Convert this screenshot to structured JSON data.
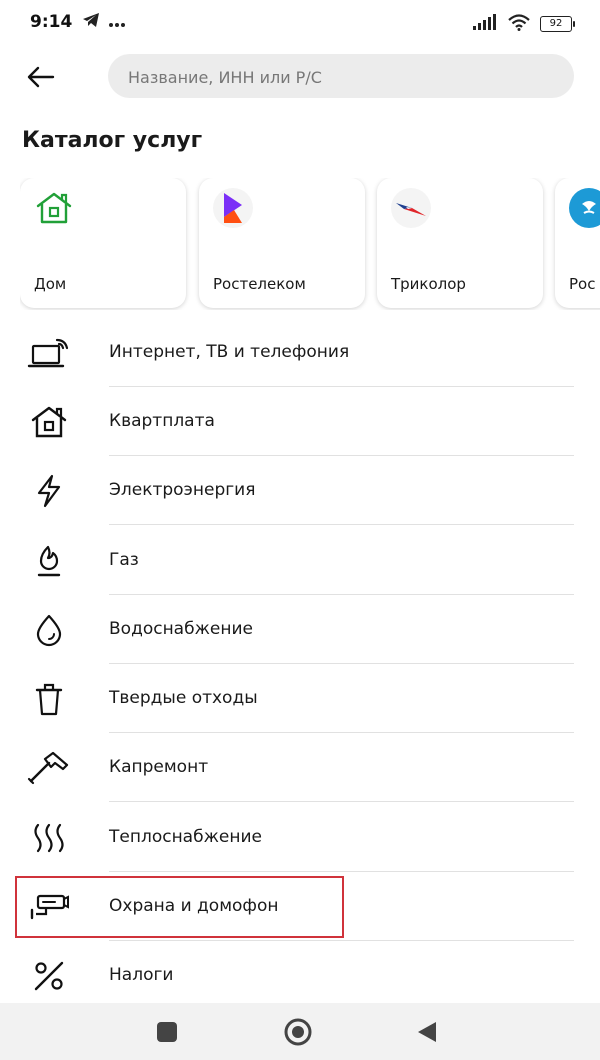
{
  "status_bar": {
    "time": "9:14",
    "battery": "92"
  },
  "header": {
    "search_placeholder": "Название, ИНН или Р/С"
  },
  "page_title": "Каталог услуг",
  "providers": [
    {
      "label": "Дом",
      "icon": "house-icon"
    },
    {
      "label": "Ростелеком",
      "icon": "rostelecom-logo"
    },
    {
      "label": "Триколор",
      "icon": "tricolor-logo"
    },
    {
      "label": "Рос",
      "icon": "rosreestr-logo"
    }
  ],
  "services": [
    {
      "label": "Интернет, ТВ и телефония",
      "icon": "laptop-wifi-icon"
    },
    {
      "label": "Квартплата",
      "icon": "house-icon"
    },
    {
      "label": "Электроэнергия",
      "icon": "lightning-icon"
    },
    {
      "label": "Газ",
      "icon": "flame-icon"
    },
    {
      "label": "Водоснабжение",
      "icon": "water-drop-icon"
    },
    {
      "label": "Твердые отходы",
      "icon": "trash-icon"
    },
    {
      "label": "Капремонт",
      "icon": "hammer-icon"
    },
    {
      "label": "Теплоснабжение",
      "icon": "heat-icon"
    },
    {
      "label": "Охрана и домофон",
      "icon": "security-camera-icon"
    },
    {
      "label": "Налоги",
      "icon": "percent-icon"
    }
  ],
  "colors": {
    "highlight": "#d0333b",
    "home_green": "#21a038",
    "rostelecom_purple": "#7b2ff7",
    "rostelecom_orange": "#ff4f12"
  }
}
